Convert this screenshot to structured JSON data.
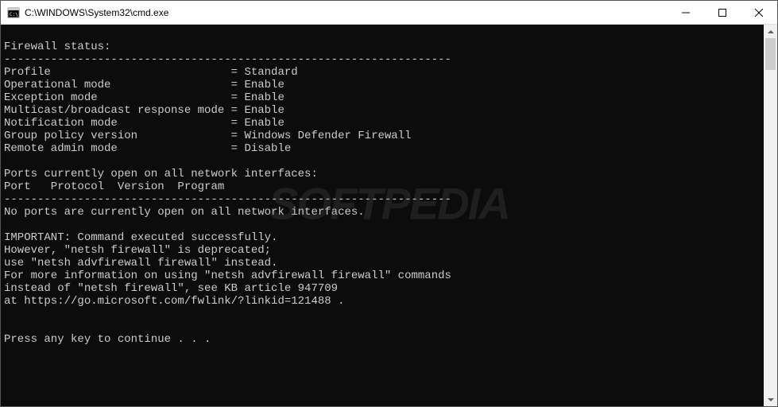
{
  "window": {
    "title": "C:\\WINDOWS\\System32\\cmd.exe"
  },
  "terminal": {
    "lines": [
      "",
      "Firewall status:",
      "-------------------------------------------------------------------",
      "Profile                           = Standard",
      "Operational mode                  = Enable",
      "Exception mode                    = Enable",
      "Multicast/broadcast response mode = Enable",
      "Notification mode                 = Enable",
      "Group policy version              = Windows Defender Firewall",
      "Remote admin mode                 = Disable",
      "",
      "Ports currently open on all network interfaces:",
      "Port   Protocol  Version  Program",
      "-------------------------------------------------------------------",
      "No ports are currently open on all network interfaces.",
      "",
      "IMPORTANT: Command executed successfully.",
      "However, \"netsh firewall\" is deprecated;",
      "use \"netsh advfirewall firewall\" instead.",
      "For more information on using \"netsh advfirewall firewall\" commands",
      "instead of \"netsh firewall\", see KB article 947709",
      "at https://go.microsoft.com/fwlink/?linkid=121488 .",
      "",
      "",
      "Press any key to continue . . ."
    ]
  },
  "watermark": "SOFTPEDIA"
}
